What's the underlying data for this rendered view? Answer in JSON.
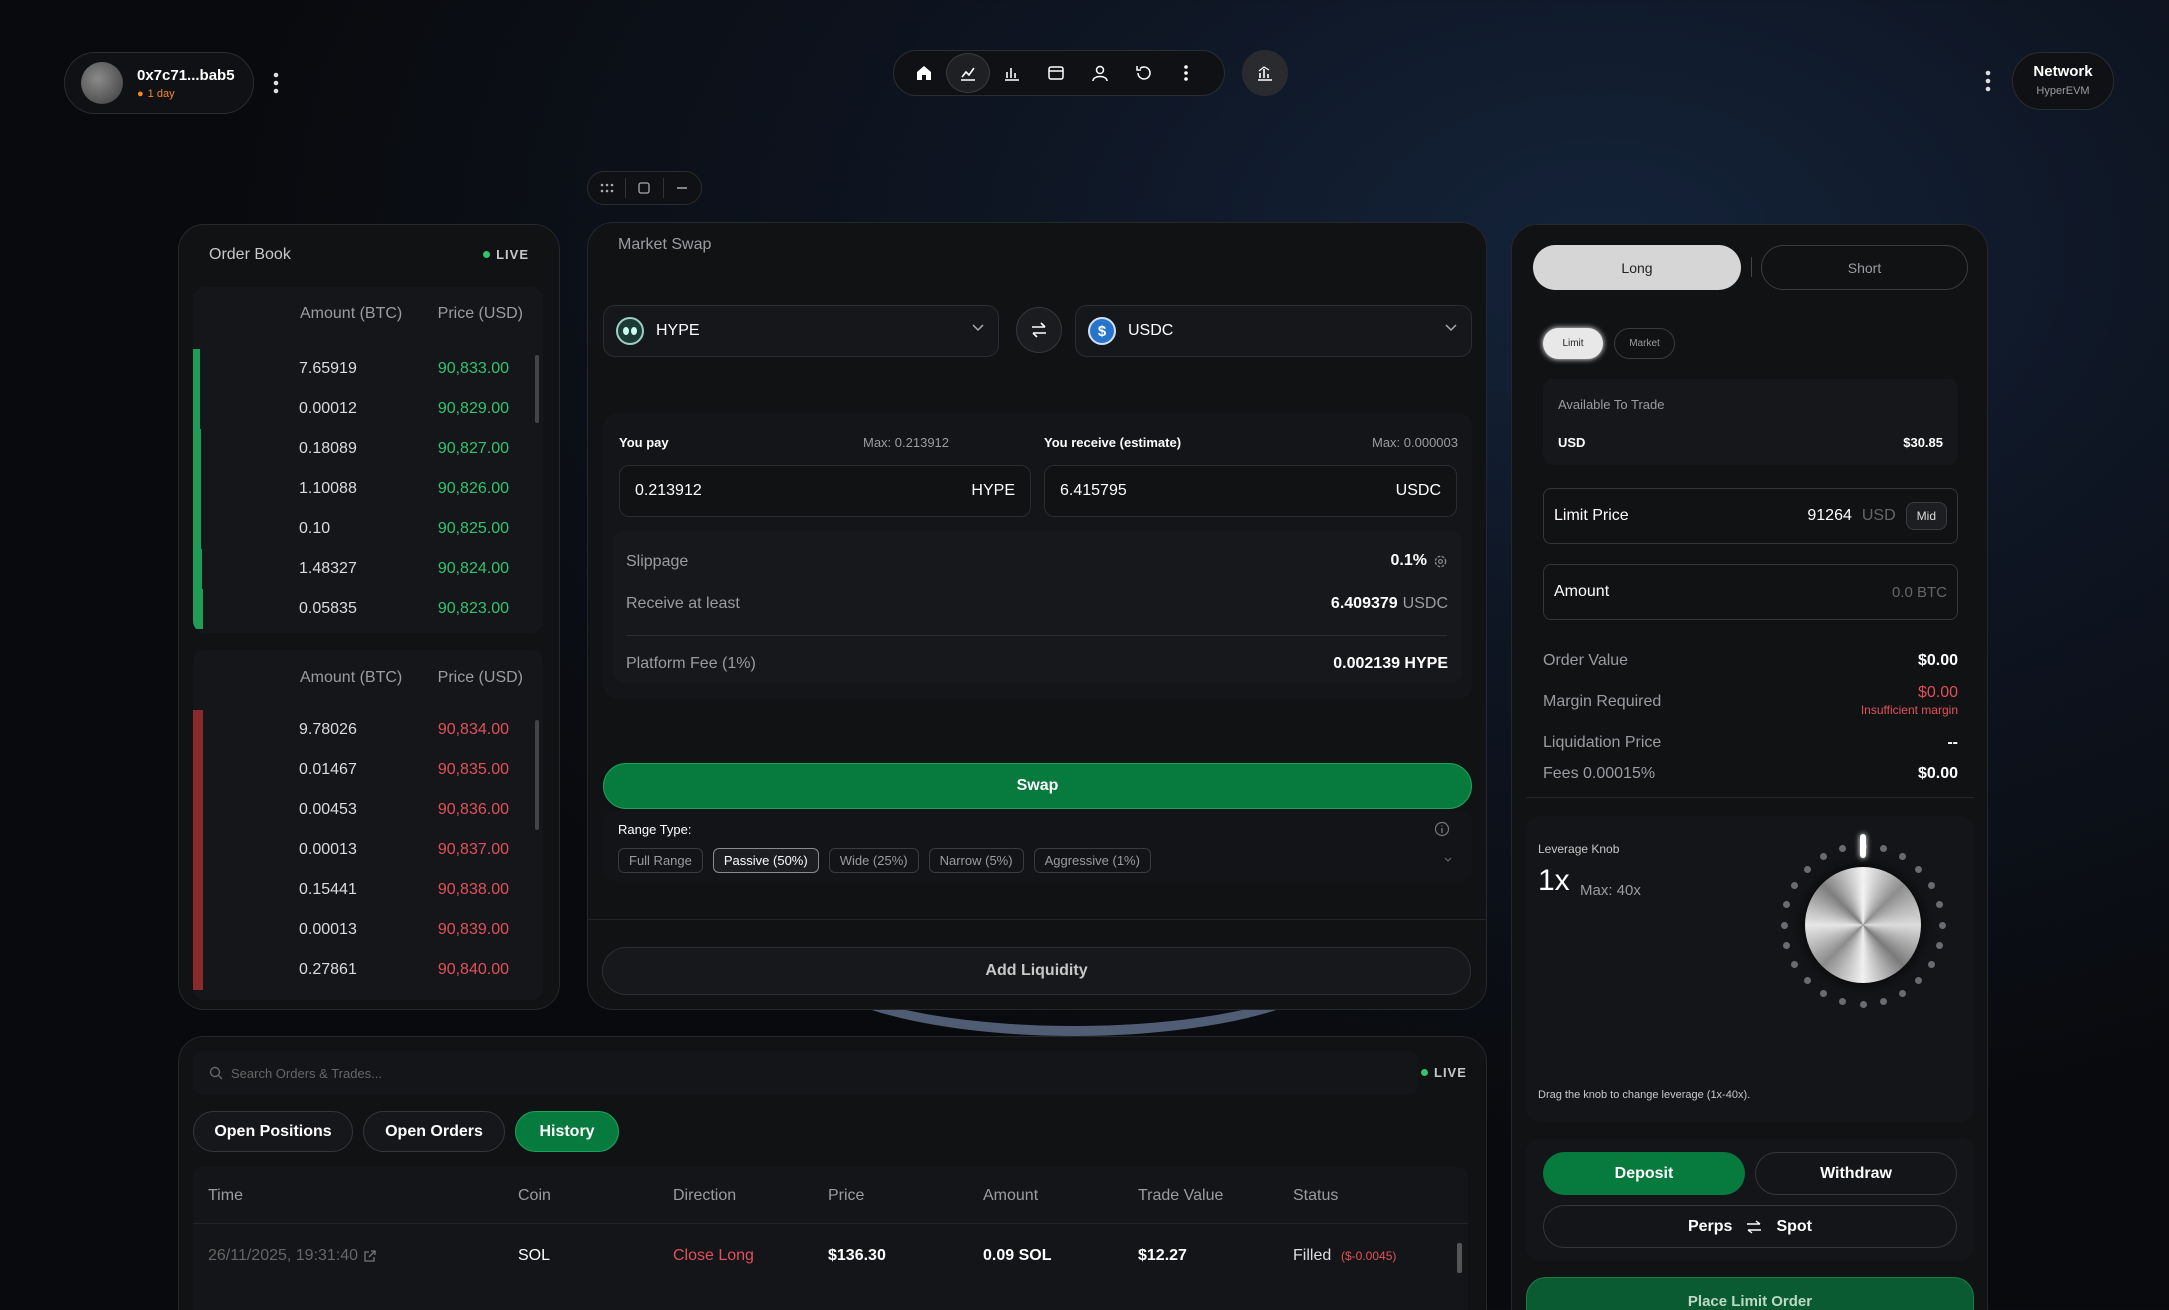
{
  "header": {
    "wallet_address": "0x7c71...bab5",
    "streak": "1 day",
    "network_label": "Network",
    "network_name": "HyperEVM"
  },
  "orderbook": {
    "title": "Order Book",
    "live": "LIVE",
    "col_amount": "Amount (BTC)",
    "col_price": "Price (USD)",
    "bids": [
      {
        "amount": "7.65919",
        "price": "90,833.00",
        "depth": 0.2
      },
      {
        "amount": "0.00012",
        "price": "90,829.00",
        "depth": 0.2
      },
      {
        "amount": "0.18089",
        "price": "90,827.00",
        "depth": 0.22
      },
      {
        "amount": "1.10088",
        "price": "90,826.00",
        "depth": 0.24
      },
      {
        "amount": "0.10",
        "price": "90,825.00",
        "depth": 0.24
      },
      {
        "amount": "1.48327",
        "price": "90,824.00",
        "depth": 0.26
      },
      {
        "amount": "0.05835",
        "price": "90,823.00",
        "depth": 0.28
      }
    ],
    "asks": [
      {
        "amount": "9.78026",
        "price": "90,834.00",
        "depth": 0.28
      },
      {
        "amount": "0.01467",
        "price": "90,835.00",
        "depth": 0.28
      },
      {
        "amount": "0.00453",
        "price": "90,836.00",
        "depth": 0.28
      },
      {
        "amount": "0.00013",
        "price": "90,837.00",
        "depth": 0.28
      },
      {
        "amount": "0.15441",
        "price": "90,838.00",
        "depth": 0.28
      },
      {
        "amount": "0.00013",
        "price": "90,839.00",
        "depth": 0.28
      },
      {
        "amount": "0.27861",
        "price": "90,840.00",
        "depth": 0.28
      }
    ]
  },
  "swap": {
    "title": "Market Swap",
    "from_token": "HYPE",
    "to_token": "USDC",
    "you_pay_label": "You pay",
    "you_pay_max": "Max: 0.213912",
    "you_receive_label": "You receive (estimate)",
    "you_receive_max": "Max: 0.000003",
    "pay_value": "0.213912",
    "pay_token": "HYPE",
    "receive_value": "6.415795",
    "receive_token": "USDC",
    "slippage_label": "Slippage",
    "slippage_value": "0.1%",
    "receive_least_label": "Receive at least",
    "receive_least_value": "6.409379",
    "receive_least_unit": "USDC",
    "fee_label": "Platform Fee (1%)",
    "fee_value": "0.002139 HYPE",
    "swap_button": "Swap",
    "range_type_label": "Range Type:",
    "ranges": [
      "Full Range",
      "Passive (50%)",
      "Wide (25%)",
      "Narrow (5%)",
      "Aggressive (1%)"
    ],
    "active_range": "Passive (50%)",
    "add_liquidity": "Add Liquidity"
  },
  "trade": {
    "long_label": "Long",
    "short_label": "Short",
    "limit_tab": "Limit",
    "market_tab": "Market",
    "available_label": "Available To Trade",
    "available_currency": "USD",
    "available_value": "$30.85",
    "limit_price_label": "Limit Price",
    "limit_price_value": "91264",
    "limit_price_unit": "USD",
    "mid_button": "Mid",
    "amount_label": "Amount",
    "amount_placeholder": "0.0 BTC",
    "order_value_label": "Order Value",
    "order_value": "$0.00",
    "margin_label": "Margin Required",
    "margin_value": "$0.00",
    "margin_warning": "Insufficient margin",
    "liq_label": "Liquidation Price",
    "liq_value": "--",
    "fees_label": "Fees 0.00015%",
    "fees_value": "$0.00",
    "leverage_title": "Leverage Knob",
    "leverage_value": "1x",
    "leverage_max": "Max: 40x",
    "leverage_hint": "Drag the knob to change leverage (1x-40x).",
    "leverage_fraction": 0.0,
    "deposit": "Deposit",
    "withdraw": "Withdraw",
    "perps": "Perps",
    "spot": "Spot",
    "place_order": "Place Limit Order"
  },
  "history": {
    "search_placeholder": "Search Orders & Trades...",
    "live": "LIVE",
    "tabs": [
      "Open Positions",
      "Open Orders",
      "History"
    ],
    "active_tab": "History",
    "columns": [
      "Time",
      "Coin",
      "Direction",
      "Price",
      "Amount",
      "Trade Value",
      "Status"
    ],
    "rows": [
      {
        "time": "26/11/2025, 19:31:40",
        "coin": "SOL",
        "direction": "Close Long",
        "price": "$136.30",
        "amount": "0.09 SOL",
        "value": "$12.27",
        "status": "Filled",
        "pnl": "($-0.0045)"
      }
    ]
  },
  "colors": {
    "accent_green": "#077a3e",
    "bid": "#1f9c55",
    "ask": "#8a2a2c",
    "price_green": "#2fc46f",
    "price_red": "#e0505a"
  }
}
